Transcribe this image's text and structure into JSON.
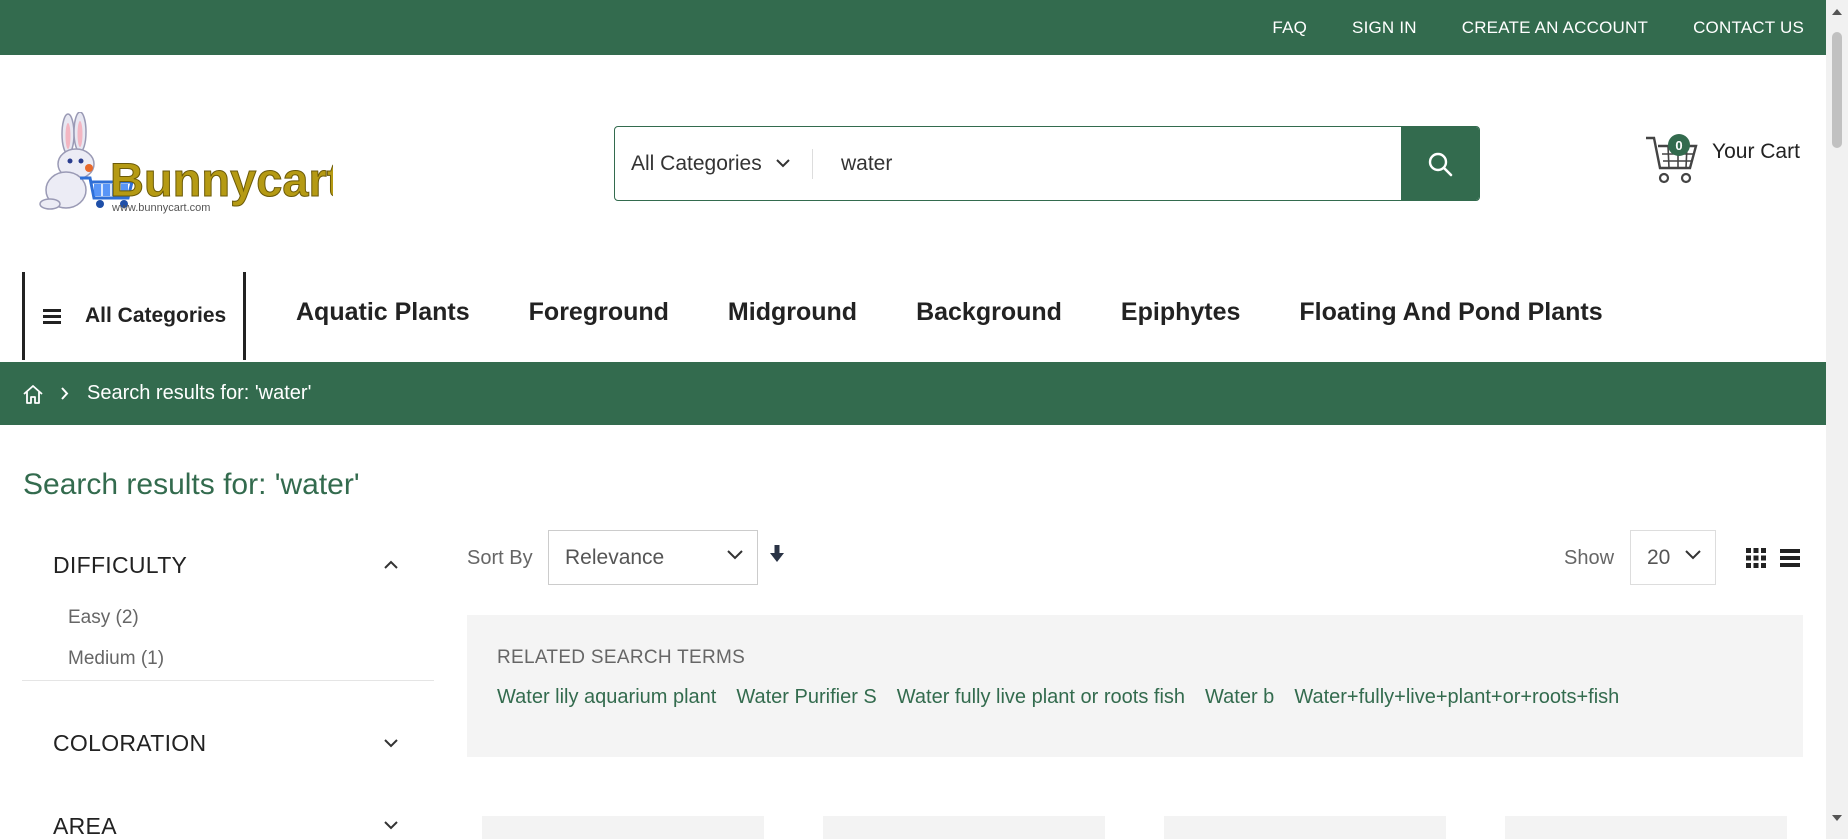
{
  "topbar": {
    "links": [
      "FAQ",
      "SIGN IN",
      "CREATE AN ACCOUNT",
      "CONTACT US"
    ],
    "color": "#336b4e"
  },
  "header": {
    "logo_text": "Bunnycart",
    "logo_url_text": "www.bunnycart.com",
    "search": {
      "category": "All Categories",
      "query": "water"
    },
    "cart": {
      "count": "0",
      "label": "Your Cart"
    }
  },
  "nav": {
    "all_categories": "All Categories",
    "items": [
      "Aquatic Plants",
      "Foreground",
      "Midground",
      "Background",
      "Epiphytes",
      "Floating And Pond Plants"
    ]
  },
  "breadcrumb": {
    "current": "Search results for: 'water'"
  },
  "page": {
    "title": "Search results for: 'water'"
  },
  "filters": [
    {
      "label": "DIFFICULTY",
      "expanded": true,
      "options": [
        "Easy (2)",
        "Medium (1)"
      ]
    },
    {
      "label": "COLORATION",
      "expanded": false,
      "options": []
    },
    {
      "label": "AREA",
      "expanded": false,
      "options": []
    }
  ],
  "toolbar": {
    "sort_label": "Sort By",
    "sort_value": "Relevance",
    "show_label": "Show",
    "show_value": "20"
  },
  "related": {
    "title": "RELATED SEARCH TERMS",
    "terms": [
      "Water lily aquarium plant",
      "Water Purifier S",
      "Water fully live plant or roots fish",
      "Water b",
      "Water+fully+live+plant+or+roots+fish"
    ]
  },
  "icons": {
    "home": "home-icon",
    "search": "search-icon",
    "cart": "cart-icon",
    "menu": "menu-icon",
    "grid": "grid-view-icon",
    "list": "list-view-icon"
  }
}
